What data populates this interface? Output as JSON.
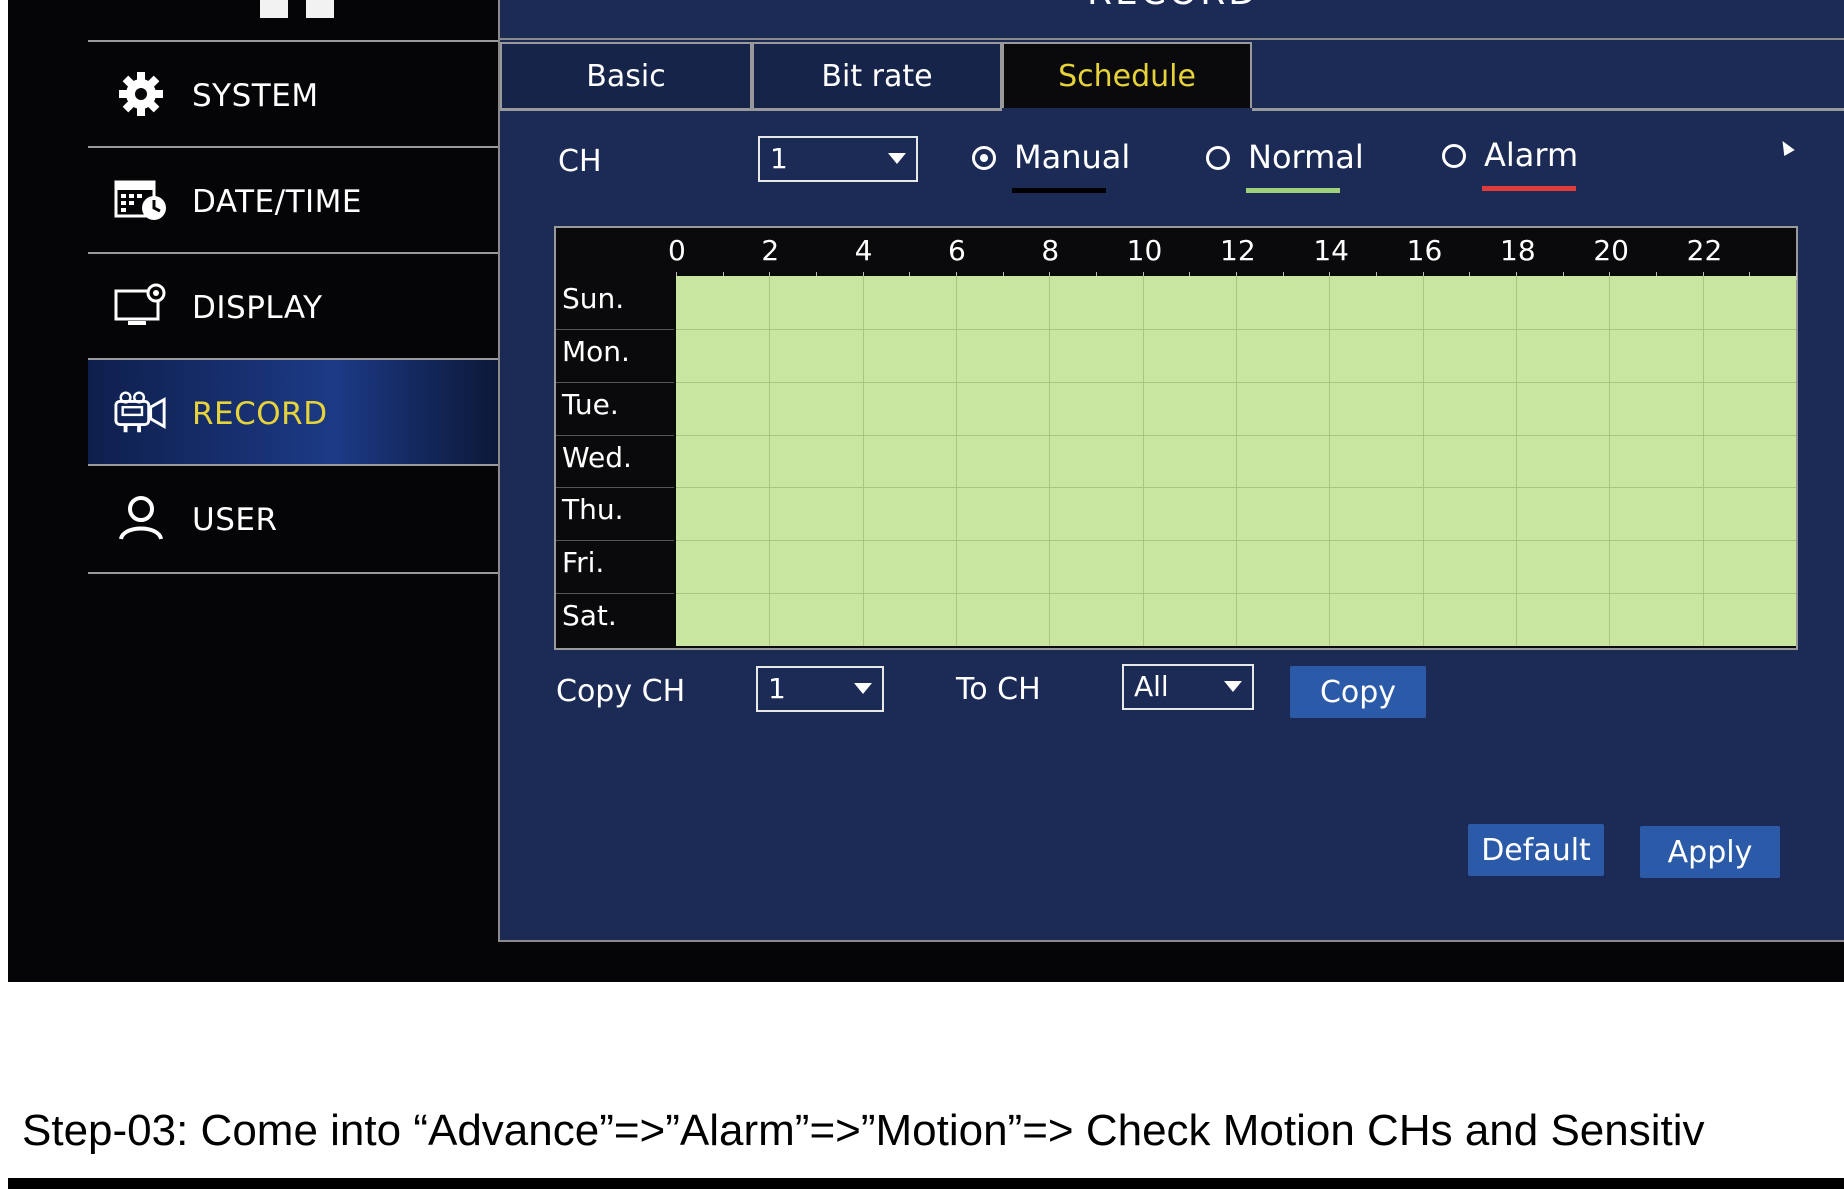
{
  "screen": {
    "title": "RECORD"
  },
  "sidebar": {
    "items": [
      {
        "label": "SYSTEM",
        "icon": "gear-icon",
        "active": false
      },
      {
        "label": "DATE/TIME",
        "icon": "calendar-clock-icon",
        "active": false
      },
      {
        "label": "DISPLAY",
        "icon": "monitor-gear-icon",
        "active": false
      },
      {
        "label": "RECORD",
        "icon": "camera-icon",
        "active": true
      },
      {
        "label": "USER",
        "icon": "user-icon",
        "active": false
      }
    ]
  },
  "tabs": [
    {
      "label": "Basic",
      "active": false
    },
    {
      "label": "Bit rate",
      "active": false
    },
    {
      "label": "Schedule",
      "active": true
    }
  ],
  "controls": {
    "ch_label": "CH",
    "ch_value": "1",
    "record_modes": [
      {
        "label": "Manual",
        "checked": true,
        "color": "#000000"
      },
      {
        "label": "Normal",
        "checked": false,
        "color": "#9fd17a"
      },
      {
        "label": "Alarm",
        "checked": false,
        "color": "#e03a3a"
      }
    ]
  },
  "schedule": {
    "hour_labels": [
      "0",
      "2",
      "4",
      "6",
      "8",
      "10",
      "12",
      "14",
      "16",
      "18",
      "20",
      "22"
    ],
    "days": [
      "Sun.",
      "Mon.",
      "Tue.",
      "Wed.",
      "Thu.",
      "Fri.",
      "Sat."
    ],
    "fill_color": "#c8e6a0",
    "coverage": "all days, all hours (Normal)"
  },
  "copy": {
    "copy_ch_label": "Copy CH",
    "copy_ch_value": "1",
    "to_ch_label": "To CH",
    "to_ch_value": "All",
    "copy_button": "Copy"
  },
  "footer_buttons": {
    "default": "Default",
    "apply": "Apply"
  },
  "caption": "Step-03: Come into “Advance”=>”Alarm”=>”Motion”=> Check Motion CHs and Sensitiv",
  "colors": {
    "panel_bg": "#1c2b55",
    "accent_text": "#e6d33a",
    "button_bg": "#2b5aa8",
    "screen_bg": "#050507"
  }
}
